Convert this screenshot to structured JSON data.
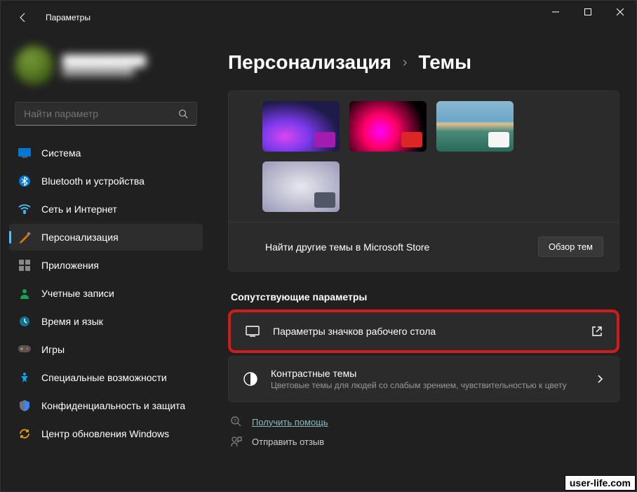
{
  "window": {
    "title": "Параметры"
  },
  "profile": {
    "name": "████████████",
    "email": "████████████"
  },
  "search": {
    "placeholder": "Найти параметр"
  },
  "nav": {
    "items": [
      {
        "label": "Система"
      },
      {
        "label": "Bluetooth и устройства"
      },
      {
        "label": "Сеть и Интернет"
      },
      {
        "label": "Персонализация"
      },
      {
        "label": "Приложения"
      },
      {
        "label": "Учетные записи"
      },
      {
        "label": "Время и язык"
      },
      {
        "label": "Игры"
      },
      {
        "label": "Специальные возможности"
      },
      {
        "label": "Конфиденциальность и защита"
      },
      {
        "label": "Центр обновления Windows"
      }
    ],
    "active_index": 3
  },
  "breadcrumb": {
    "parent": "Персонализация",
    "current": "Темы"
  },
  "themes": {
    "store_text": "Найти другие темы в Microsoft Store",
    "store_button": "Обзор тем"
  },
  "related": {
    "title": "Сопутствующие параметры",
    "items": [
      {
        "title": "Параметры значков рабочего стола",
        "desc": ""
      },
      {
        "title": "Контрастные темы",
        "desc": "Цветовые темы для людей со слабым зрением, чувствительностью к цвету"
      }
    ]
  },
  "footer": {
    "help": "Получить помощь",
    "feedback": "Отправить отзыв"
  },
  "watermark": "user-life.com"
}
